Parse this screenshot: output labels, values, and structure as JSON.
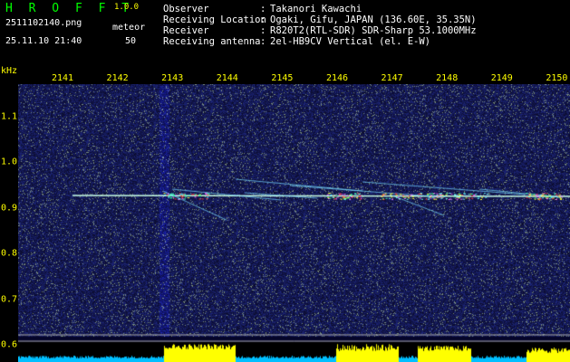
{
  "header": {
    "app_title": "H R O F F T",
    "app_version": "1.0.0",
    "file_name": "2511102140.png",
    "date_time": "25.11.10 21:40",
    "meteor_label": "meteor",
    "meteor_count": "50"
  },
  "info": [
    {
      "label": "Observer",
      "colon": ":",
      "value": "Takanori Kawachi"
    },
    {
      "label": "Receiving Location",
      "colon": ":",
      "value": "Ogaki, Gifu, JAPAN (136.60E, 35.35N)"
    },
    {
      "label": "Receiver",
      "colon": ":",
      "value": "R820T2(RTL-SDR) SDR-Sharp 53.1000MHz"
    },
    {
      "label": "Receiving antenna",
      "colon": ":",
      "value": "2el-HB9CV Vertical (el. E-W)"
    }
  ],
  "axes": {
    "y_unit": "kHz",
    "x_ticks": [
      "2141",
      "2142",
      "2143",
      "2144",
      "2145",
      "2146",
      "2147",
      "2148",
      "2149",
      "2150"
    ],
    "y_ticks": [
      "1.1",
      "1.0",
      "0.9",
      "0.8",
      "0.7",
      "0.6"
    ]
  },
  "colors": {
    "header_white": "#ffffff",
    "header_yellow": "#ffff00",
    "title_green": "#00ff00",
    "background": "#000000",
    "noise_base": "#0a0a55",
    "carrier": "#c8ffe6",
    "signal_strength": "#ffff00"
  }
}
